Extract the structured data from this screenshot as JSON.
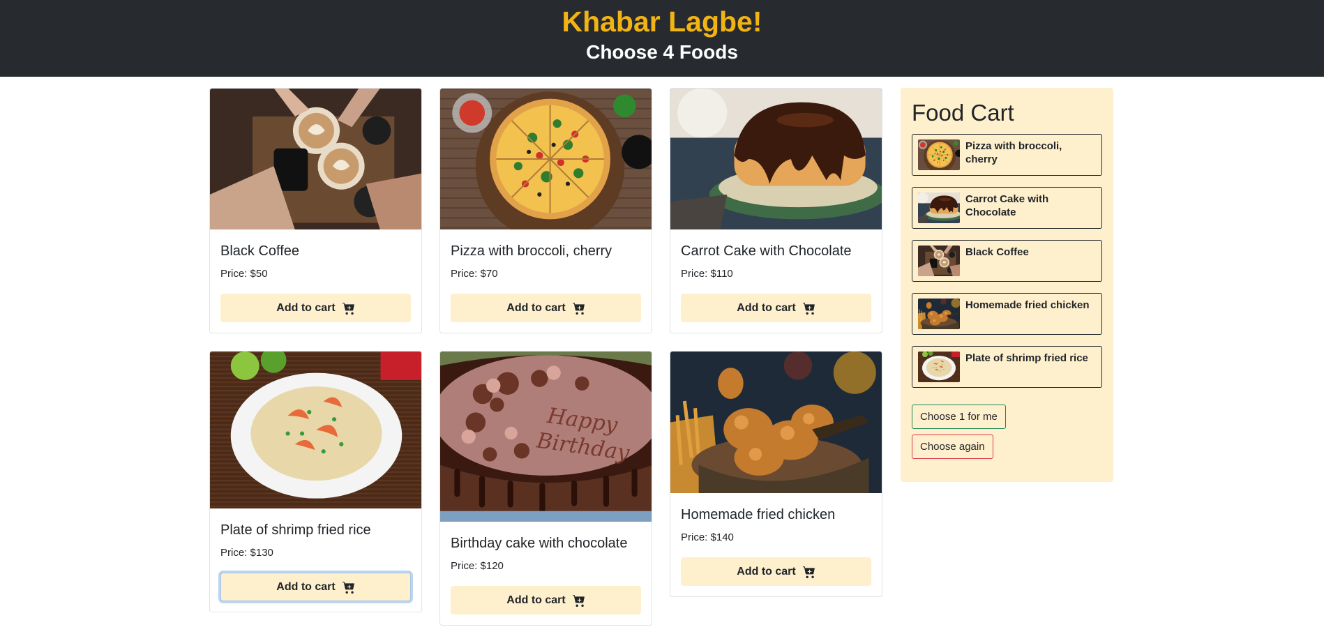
{
  "header": {
    "title": "Khabar Lagbe!",
    "subtitle": "Choose 4 Foods"
  },
  "foods": [
    {
      "name": "Black Coffee",
      "price": "Price: $50",
      "button": "Add to cart",
      "image": "coffee"
    },
    {
      "name": "Pizza with broccoli, cherry",
      "price": "Price: $70",
      "button": "Add to cart",
      "image": "pizza"
    },
    {
      "name": "Carrot Cake with Chocolate",
      "price": "Price: $110",
      "button": "Add to cart",
      "image": "cake"
    },
    {
      "name": "Plate of shrimp fried rice",
      "price": "Price: $130",
      "button": "Add to cart",
      "image": "rice"
    },
    {
      "name": "Birthday cake with chocolate",
      "price": "Price: $120",
      "button": "Add to cart",
      "image": "birthday"
    },
    {
      "name": "Homemade fried chicken",
      "price": "Price: $140",
      "button": "Add to cart",
      "image": "chicken"
    }
  ],
  "cart": {
    "title": "Food Cart",
    "items": [
      {
        "name": "Pizza with broccoli, cherry"
      },
      {
        "name": "Carrot Cake with Chocolate"
      },
      {
        "name": "Black Coffee"
      },
      {
        "name": "Homemade fried chicken"
      },
      {
        "name": "Plate of shrimp fried rice"
      }
    ],
    "choose_one_label": "Choose 1 for me",
    "choose_again_label": "Choose again"
  },
  "colors": {
    "header_bg": "#272b2f",
    "title_accent": "#f2b415",
    "button_bg": "#fff0cd",
    "cart_bg": "#fff0cd",
    "choose_one_border": "#198754",
    "choose_again_border": "#dc3545"
  },
  "icons": {
    "add_to_cart": "cart-plus-icon"
  }
}
